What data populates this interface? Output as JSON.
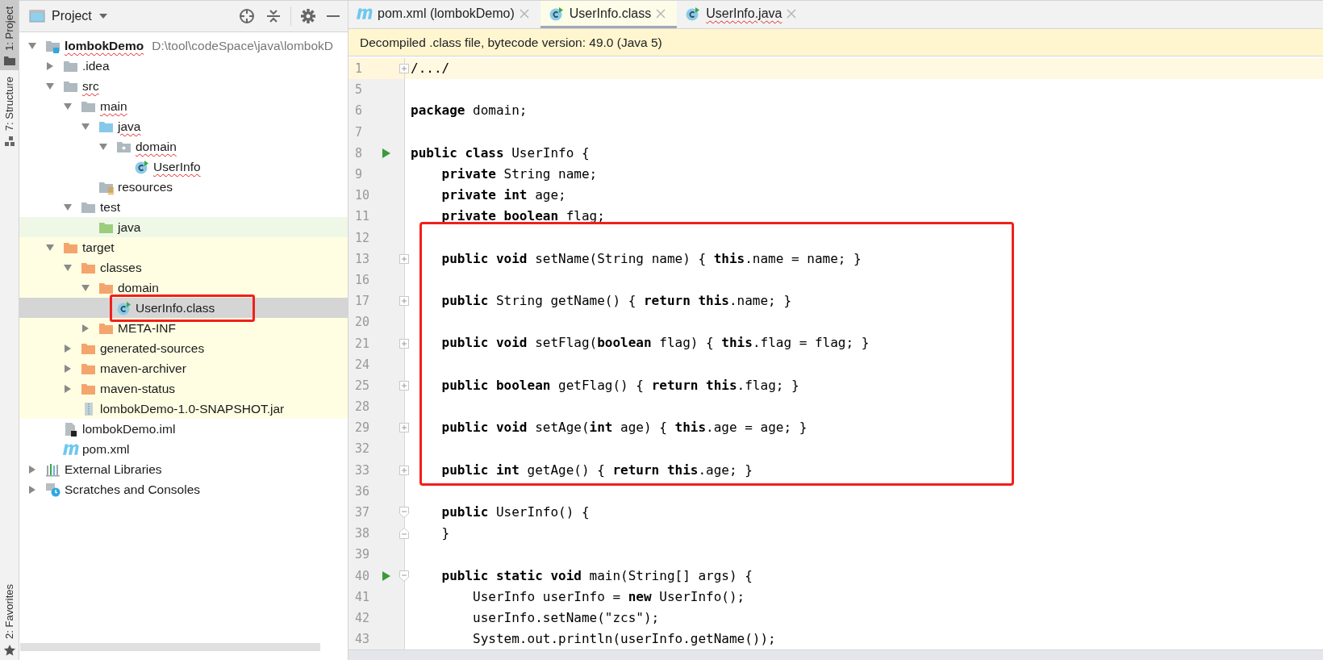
{
  "tool_strip": {
    "top": [
      {
        "label": "1: Project",
        "kind": "folder",
        "selected": true
      },
      {
        "label": "7: Structure",
        "kind": "structure",
        "selected": false
      }
    ],
    "bottom": [
      {
        "label": "2: Favorites",
        "kind": "star",
        "selected": false
      }
    ]
  },
  "project_panel": {
    "title": "Project"
  },
  "tree": [
    {
      "label": "lombokDemo",
      "path": "D:\\tool\\codeSpace\\java\\lombokD",
      "kind": "module",
      "expanded": true,
      "selected": false,
      "squiggle": true,
      "framed": false,
      "children": [
        {
          "label": ".idea",
          "kind": "folder",
          "expanded": false,
          "selected": false,
          "squiggle": false,
          "framed": false
        },
        {
          "label": "src",
          "kind": "folder",
          "expanded": true,
          "selected": false,
          "squiggle": true,
          "framed": false,
          "children": [
            {
              "label": "main",
              "kind": "folder",
              "expanded": true,
              "selected": false,
              "squiggle": true,
              "framed": false,
              "children": [
                {
                  "label": "java",
                  "kind": "source",
                  "expanded": true,
                  "selected": false,
                  "squiggle": true,
                  "framed": false,
                  "children": [
                    {
                      "label": "domain",
                      "kind": "package",
                      "expanded": true,
                      "selected": false,
                      "squiggle": true,
                      "framed": false,
                      "children": [
                        {
                          "label": "UserInfo",
                          "kind": "class",
                          "selected": false,
                          "squiggle": true,
                          "framed": false
                        }
                      ]
                    }
                  ]
                },
                {
                  "label": "resources",
                  "kind": "resources",
                  "selected": false,
                  "squiggle": false,
                  "framed": false
                }
              ]
            },
            {
              "label": "test",
              "kind": "folder",
              "expanded": true,
              "selected": false,
              "squiggle": false,
              "framed": false,
              "children": [
                {
                  "label": "java",
                  "kind": "test",
                  "selected": false,
                  "squiggle": false,
                  "framed": false
                }
              ]
            }
          ]
        },
        {
          "label": "target",
          "kind": "excluded",
          "expanded": true,
          "selected": false,
          "squiggle": false,
          "framed": false,
          "children": [
            {
              "label": "classes",
              "kind": "excluded",
              "expanded": true,
              "selected": false,
              "squiggle": false,
              "framed": false,
              "children": [
                {
                  "label": "domain",
                  "kind": "excluded",
                  "expanded": true,
                  "selected": false,
                  "squiggle": false,
                  "framed": false,
                  "children": [
                    {
                      "label": "UserInfo.class",
                      "kind": "class",
                      "selected": true,
                      "squiggle": false,
                      "framed": true
                    }
                  ]
                },
                {
                  "label": "META-INF",
                  "kind": "excluded",
                  "expanded": false,
                  "selected": false,
                  "squiggle": false,
                  "framed": false
                }
              ]
            },
            {
              "label": "generated-sources",
              "kind": "excluded",
              "expanded": false,
              "selected": false,
              "squiggle": false,
              "framed": false
            },
            {
              "label": "maven-archiver",
              "kind": "excluded",
              "expanded": false,
              "selected": false,
              "squiggle": false,
              "framed": false
            },
            {
              "label": "maven-status",
              "kind": "excluded",
              "expanded": false,
              "selected": false,
              "squiggle": false,
              "framed": false
            },
            {
              "label": "lombokDemo-1.0-SNAPSHOT.jar",
              "kind": "jar",
              "selected": false,
              "squiggle": false,
              "framed": false
            }
          ]
        },
        {
          "label": "lombokDemo.iml",
          "kind": "iml",
          "selected": false,
          "squiggle": false,
          "framed": false
        },
        {
          "label": "pom.xml",
          "kind": "maven",
          "selected": false,
          "squiggle": false,
          "framed": false
        }
      ]
    },
    {
      "label": "External Libraries",
      "kind": "libraries",
      "expanded": false,
      "selected": false,
      "squiggle": false,
      "framed": false
    },
    {
      "label": "Scratches and Consoles",
      "kind": "scratches",
      "expanded": false,
      "selected": false,
      "squiggle": false,
      "framed": false
    }
  ],
  "tabs": [
    {
      "label": "pom.xml (lombokDemo)",
      "kind": "maven",
      "selected": false,
      "squiggle": false
    },
    {
      "label": "UserInfo.class",
      "kind": "class",
      "selected": true,
      "squiggle": false
    },
    {
      "label": "UserInfo.java",
      "kind": "class",
      "selected": false,
      "squiggle": true
    }
  ],
  "info_bar": "Decompiled .class file, bytecode version: 49.0 (Java 5)",
  "code": [
    {
      "framed": false,
      "lines": [
        {
          "number": "1",
          "text": "/.../",
          "kind": "collapsed",
          "current": true
        },
        {
          "number": "5"
        },
        {
          "number": "6",
          "text": "**package** domain;"
        },
        {
          "number": "7"
        },
        {
          "number": "8",
          "text": "**public class** UserInfo {",
          "run": true
        },
        {
          "number": "9",
          "text": "    **private** String name;"
        },
        {
          "number": "10",
          "text": "    **private int** age;"
        },
        {
          "number": "11",
          "text": "    **private boolean** flag;"
        }
      ]
    },
    {
      "framed": true,
      "lines": [
        {
          "number": "12"
        },
        {
          "number": "13",
          "text": "    **public void** setName(String name) { **this**.name = name; }",
          "kind": "collapsed"
        },
        {
          "number": "16"
        },
        {
          "number": "17",
          "text": "    **public** String getName() { **return this**.name; }",
          "kind": "collapsed"
        },
        {
          "number": "20"
        },
        {
          "number": "21",
          "text": "    **public void** setFlag(**boolean** flag) { **this**.flag = flag; }",
          "kind": "collapsed"
        },
        {
          "number": "24"
        },
        {
          "number": "25",
          "text": "    **public boolean** getFlag() { **return this**.flag; }",
          "kind": "collapsed"
        },
        {
          "number": "28"
        },
        {
          "number": "29",
          "text": "    **public void** setAge(**int** age) { **this**.age = age; }",
          "kind": "collapsed"
        },
        {
          "number": "32"
        },
        {
          "number": "33",
          "text": "    **public int** getAge() { **return this**.age; }",
          "kind": "collapsed"
        }
      ]
    },
    {
      "framed": false,
      "lines": [
        {
          "number": "36"
        },
        {
          "number": "37",
          "text": "    **public** UserInfo() {",
          "kind": "open"
        },
        {
          "number": "38",
          "text": "    }",
          "kind": "close"
        },
        {
          "number": "39"
        },
        {
          "number": "40",
          "text": "    **public static void** main(String[] args) {",
          "run": true,
          "kind": "open"
        },
        {
          "number": "41",
          "text": "        UserInfo userInfo = **new** UserInfo();"
        },
        {
          "number": "42",
          "text": "        userInfo.setName(\"zcs\");"
        },
        {
          "number": "43",
          "text": "        System.out.println(userInfo.getName());"
        }
      ]
    }
  ]
}
